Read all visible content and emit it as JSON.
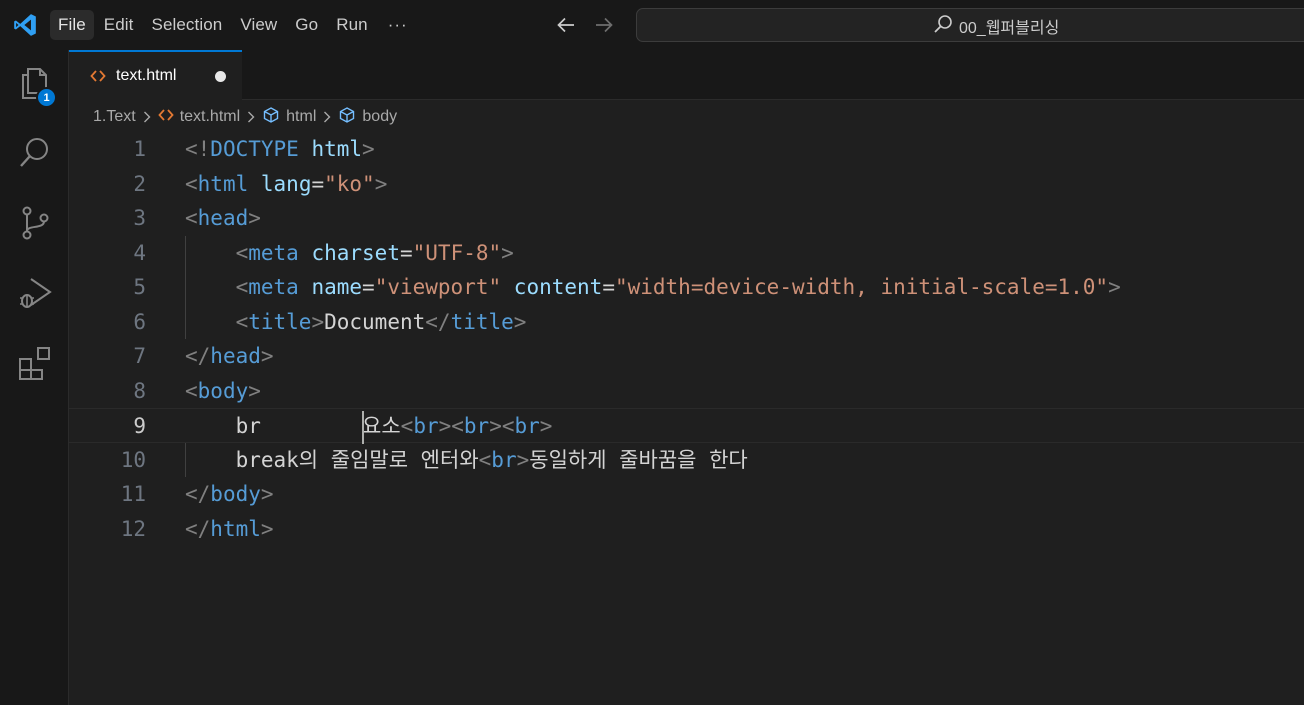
{
  "menu": {
    "items": [
      "File",
      "Edit",
      "Selection",
      "View",
      "Go",
      "Run"
    ],
    "more": "···"
  },
  "command_center": {
    "text": "00_웹퍼블리싱"
  },
  "activity": {
    "explorer_badge": "1"
  },
  "tab": {
    "label": "text.html"
  },
  "breadcrumb": [
    "1.Text",
    "text.html",
    "html",
    "body"
  ],
  "editor": {
    "current_line": 9,
    "lines": [
      {
        "n": "1",
        "indent": 0,
        "tokens": [
          [
            "p",
            "<!"
          ],
          [
            "tg",
            "DOCTYPE"
          ],
          [
            "tx",
            " "
          ],
          [
            "at",
            "html"
          ],
          [
            "p",
            ">"
          ]
        ]
      },
      {
        "n": "2",
        "indent": 0,
        "tokens": [
          [
            "p",
            "<"
          ],
          [
            "tg",
            "html"
          ],
          [
            "tx",
            " "
          ],
          [
            "at",
            "lang"
          ],
          [
            "tx",
            "="
          ],
          [
            "st",
            "\"ko\""
          ],
          [
            "p",
            ">"
          ]
        ]
      },
      {
        "n": "3",
        "indent": 0,
        "tokens": [
          [
            "p",
            "<"
          ],
          [
            "tg",
            "head"
          ],
          [
            "p",
            ">"
          ]
        ]
      },
      {
        "n": "4",
        "indent": 1,
        "tokens": [
          [
            "tx",
            "    "
          ],
          [
            "p",
            "<"
          ],
          [
            "tg",
            "meta"
          ],
          [
            "tx",
            " "
          ],
          [
            "at",
            "charset"
          ],
          [
            "tx",
            "="
          ],
          [
            "st",
            "\"UTF-8\""
          ],
          [
            "p",
            ">"
          ]
        ]
      },
      {
        "n": "5",
        "indent": 1,
        "tokens": [
          [
            "tx",
            "    "
          ],
          [
            "p",
            "<"
          ],
          [
            "tg",
            "meta"
          ],
          [
            "tx",
            " "
          ],
          [
            "at",
            "name"
          ],
          [
            "tx",
            "="
          ],
          [
            "st",
            "\"viewport\""
          ],
          [
            "tx",
            " "
          ],
          [
            "at",
            "content"
          ],
          [
            "tx",
            "="
          ],
          [
            "st",
            "\"width=device-width, initial-scale=1.0\""
          ],
          [
            "p",
            ">"
          ]
        ]
      },
      {
        "n": "6",
        "indent": 1,
        "tokens": [
          [
            "tx",
            "    "
          ],
          [
            "p",
            "<"
          ],
          [
            "tg",
            "title"
          ],
          [
            "p",
            ">"
          ],
          [
            "tx",
            "Document"
          ],
          [
            "p",
            "</"
          ],
          [
            "tg",
            "title"
          ],
          [
            "p",
            ">"
          ]
        ]
      },
      {
        "n": "7",
        "indent": 0,
        "tokens": [
          [
            "p",
            "</"
          ],
          [
            "tg",
            "head"
          ],
          [
            "p",
            ">"
          ]
        ]
      },
      {
        "n": "8",
        "indent": 0,
        "tokens": [
          [
            "p",
            "<"
          ],
          [
            "tg",
            "body"
          ],
          [
            "p",
            ">"
          ]
        ]
      },
      {
        "n": "9",
        "indent": 1,
        "tokens": [
          [
            "tx",
            "    br        "
          ],
          [
            "tx",
            "요소"
          ],
          [
            "p",
            "<"
          ],
          [
            "tg",
            "br"
          ],
          [
            "p",
            "><"
          ],
          [
            "tg",
            "br"
          ],
          [
            "p",
            "><"
          ],
          [
            "tg",
            "br"
          ],
          [
            "p",
            ">"
          ]
        ]
      },
      {
        "n": "10",
        "indent": 1,
        "tokens": [
          [
            "tx",
            "    break의 줄임말로 엔터와"
          ],
          [
            "p",
            "<"
          ],
          [
            "tg",
            "br"
          ],
          [
            "p",
            ">"
          ],
          [
            "tx",
            "동일하게 줄바꿈을 한다"
          ]
        ]
      },
      {
        "n": "11",
        "indent": 0,
        "tokens": [
          [
            "p",
            "</"
          ],
          [
            "tg",
            "body"
          ],
          [
            "p",
            ">"
          ]
        ]
      },
      {
        "n": "12",
        "indent": 0,
        "tokens": [
          [
            "p",
            "</"
          ],
          [
            "tg",
            "html"
          ],
          [
            "p",
            ">"
          ]
        ]
      }
    ]
  }
}
